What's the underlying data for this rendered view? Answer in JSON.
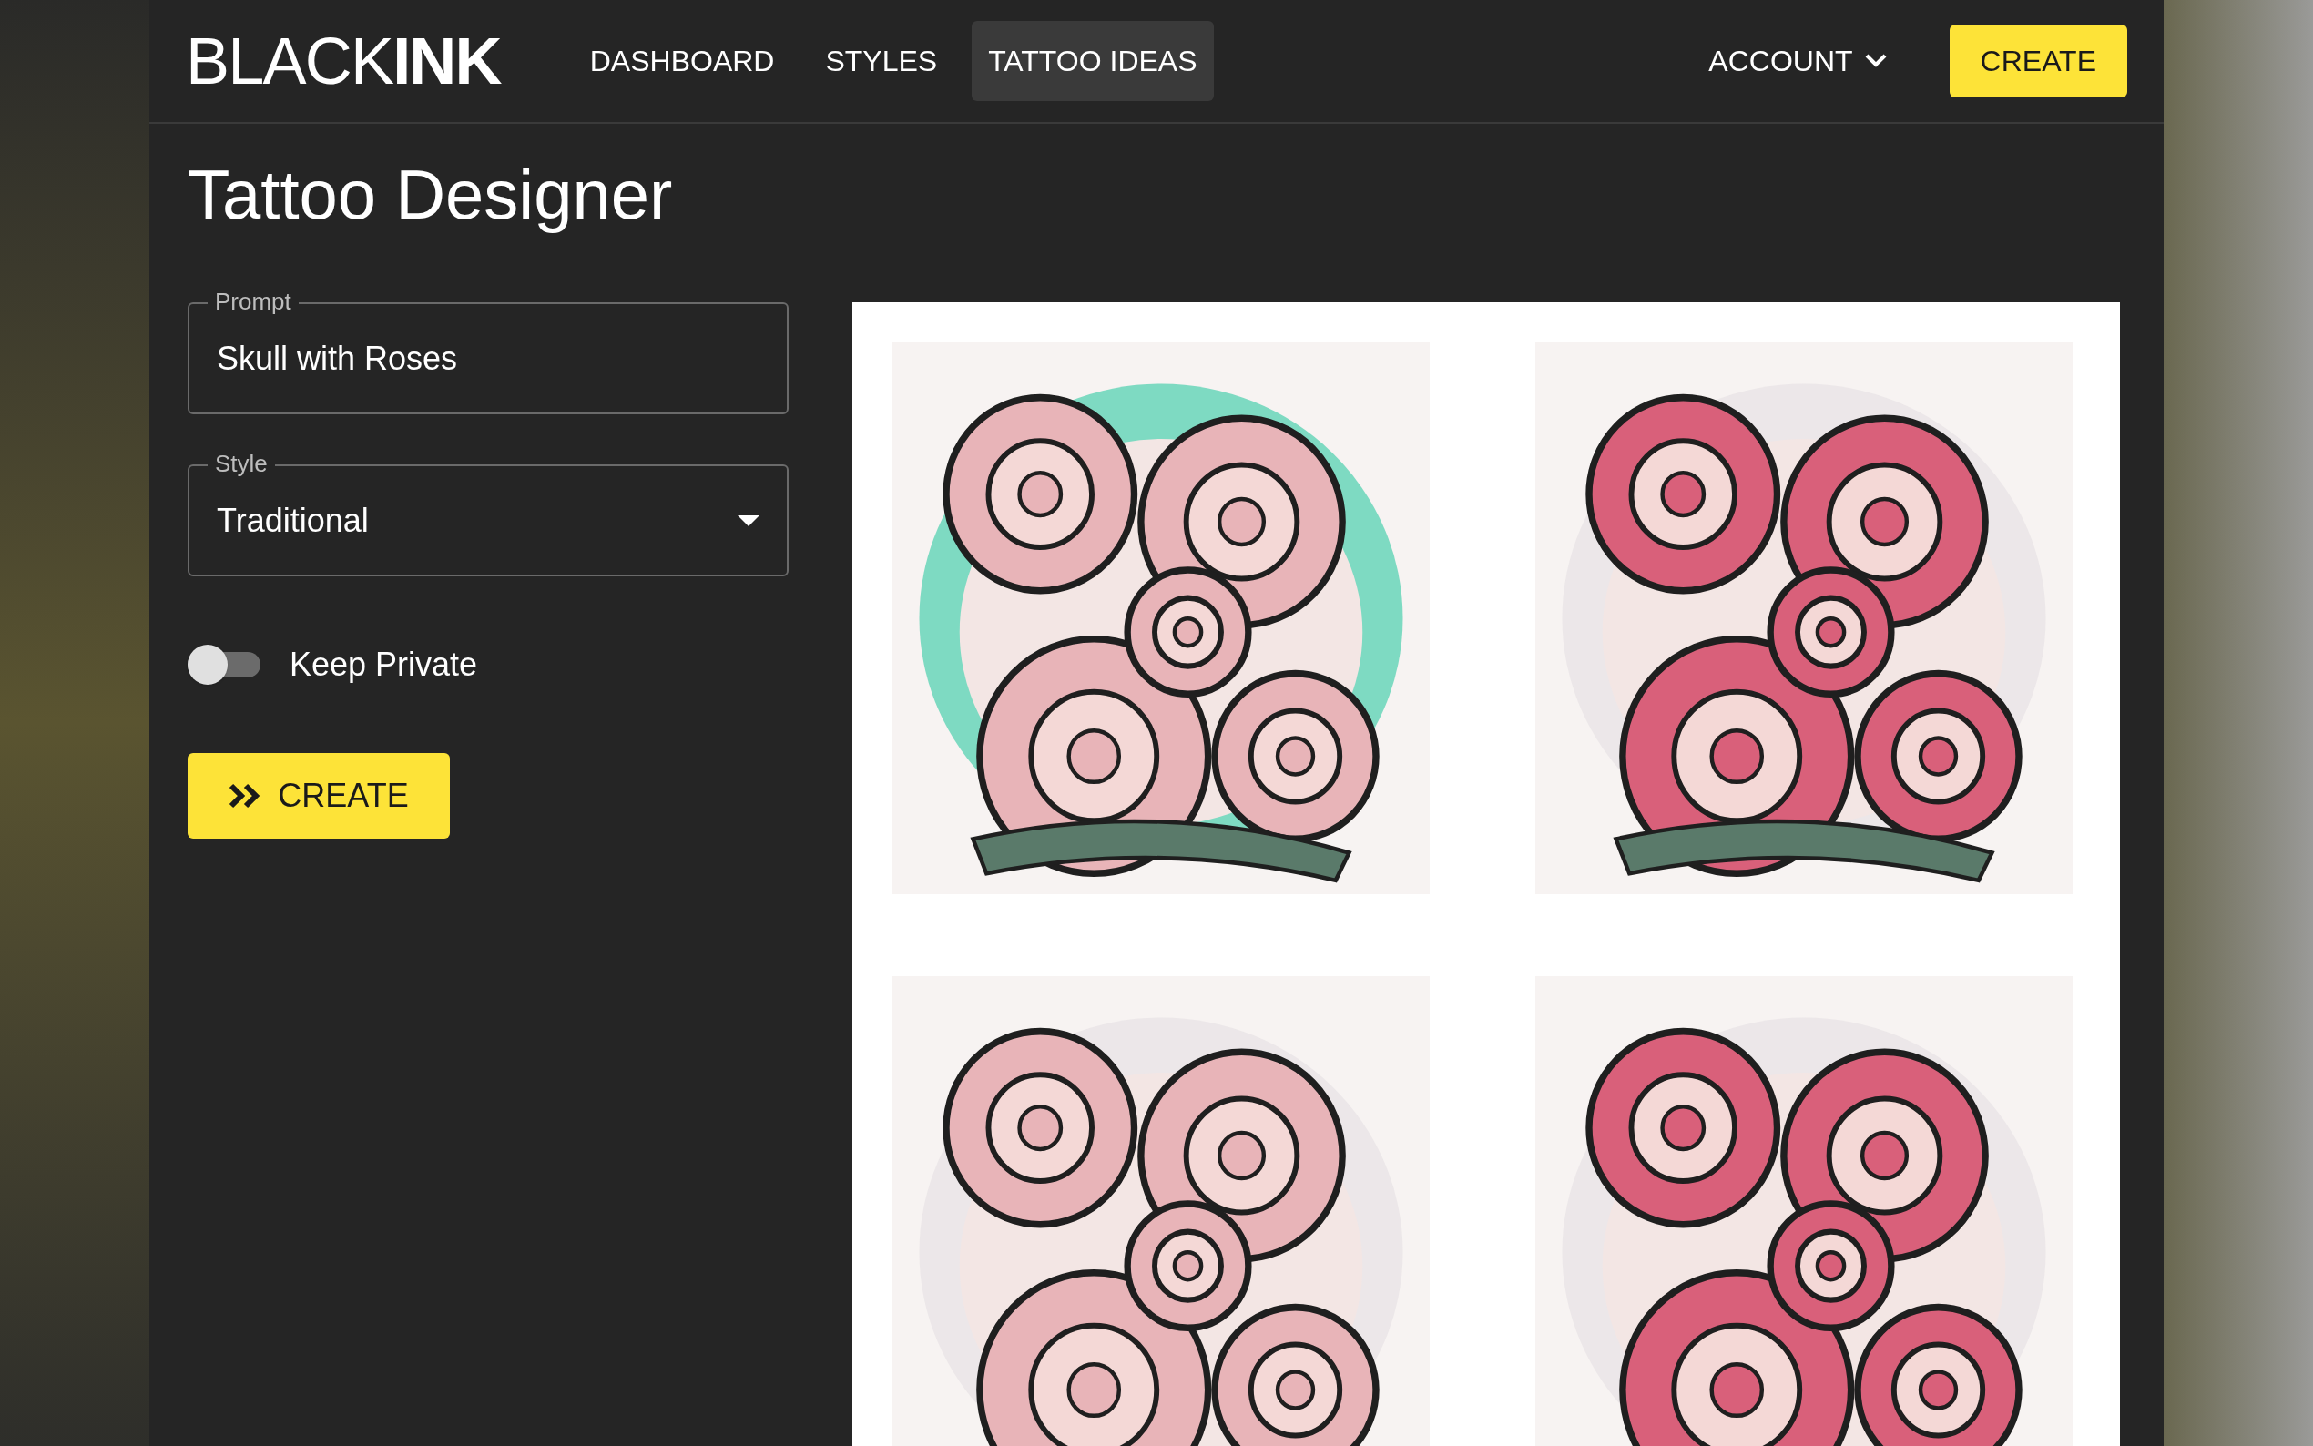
{
  "nav": {
    "logo": {
      "light": "BLACK",
      "bold": "INK"
    },
    "links": [
      {
        "label": "DASHBOARD",
        "selected": false
      },
      {
        "label": "STYLES",
        "selected": false
      },
      {
        "label": "TATTOO IDEAS",
        "selected": true
      }
    ],
    "account": "ACCOUNT",
    "create": "CREATE"
  },
  "title": "Tattoo Designer",
  "form": {
    "prompt": {
      "label": "Prompt",
      "value": "Skull with Roses"
    },
    "style": {
      "label": "Style",
      "value": "Traditional"
    },
    "private": {
      "label": "Keep Private",
      "on": false
    },
    "submit": "CREATE"
  }
}
